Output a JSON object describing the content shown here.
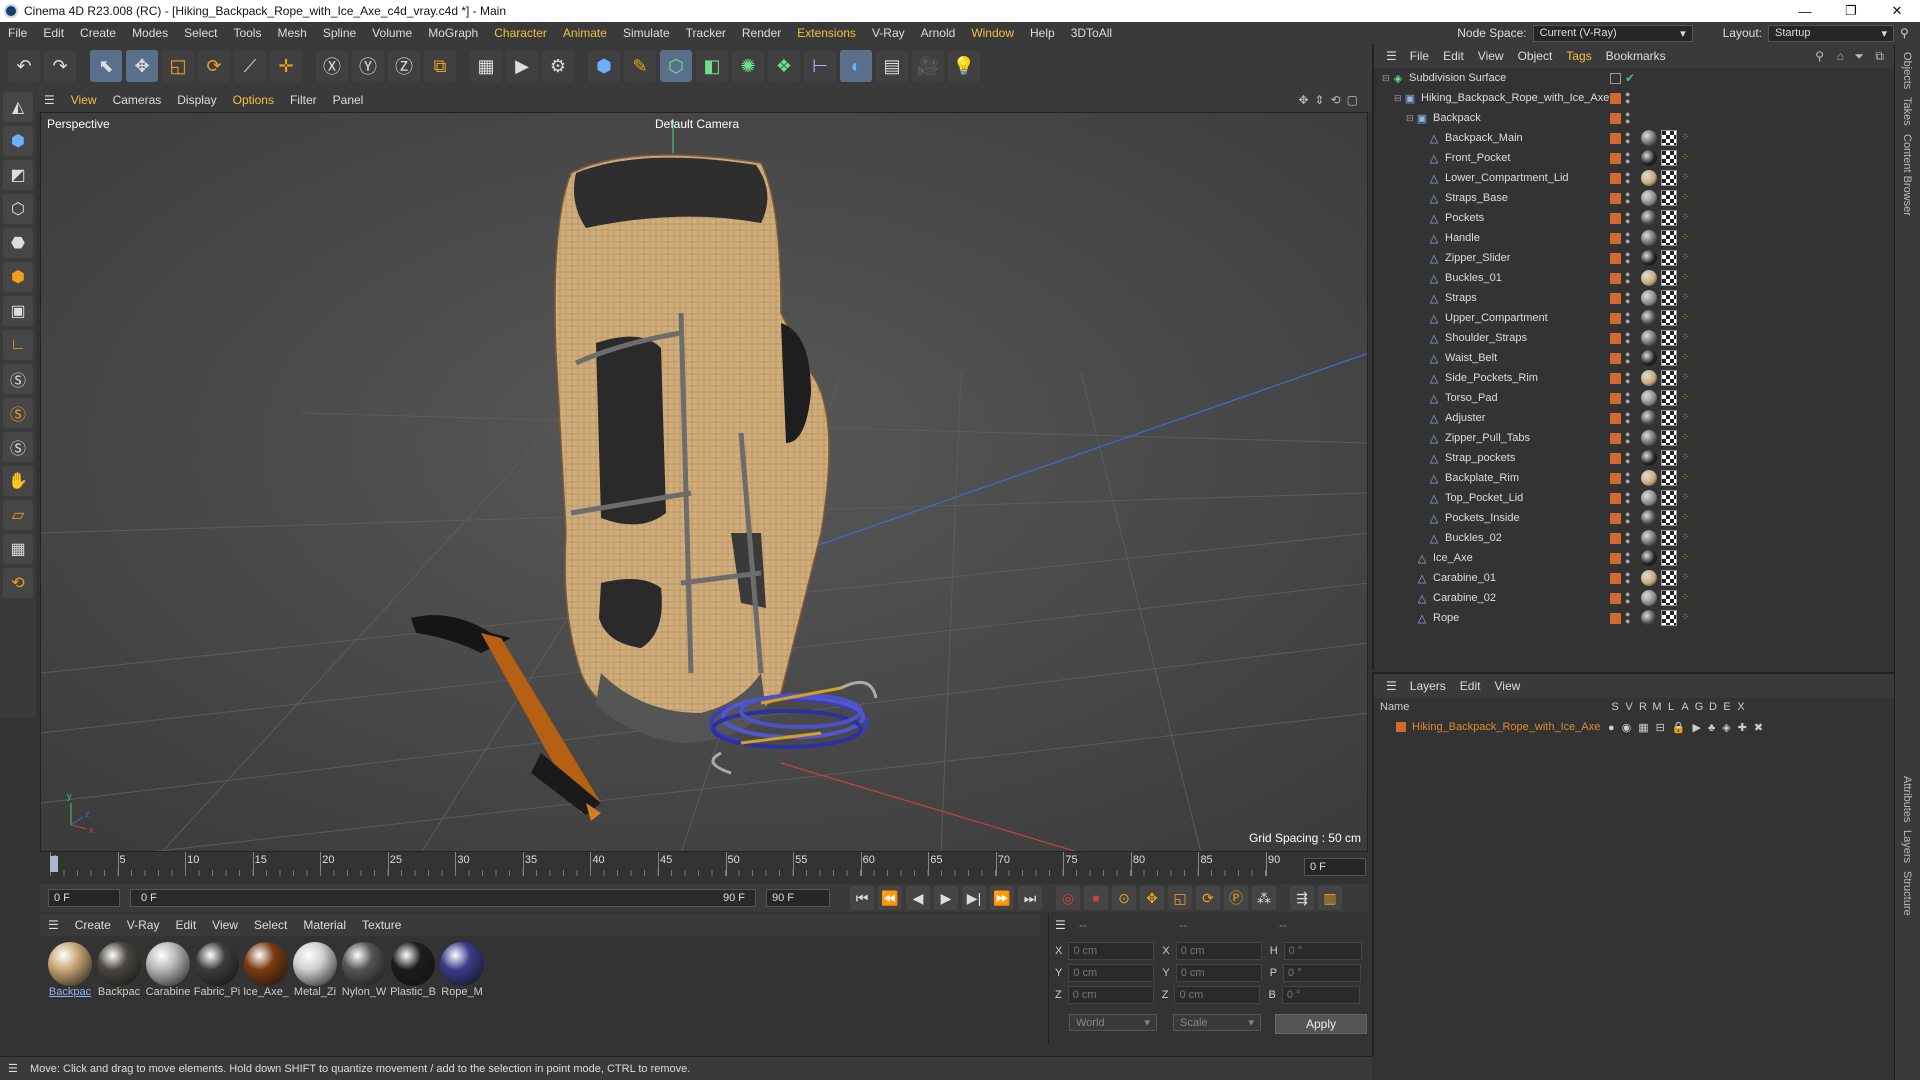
{
  "titlebar": {
    "title": "Cinema 4D R23.008 (RC) - [Hiking_Backpack_Rope_with_Ice_Axe_c4d_vray.c4d *] - Main",
    "minimize": "—",
    "maximize": "❐",
    "close": "✕"
  },
  "menubar": {
    "items": [
      "File",
      "Edit",
      "Create",
      "Modes",
      "Select",
      "Tools",
      "Mesh",
      "Spline",
      "Volume",
      "MoGraph",
      "Character",
      "Animate",
      "Simulate",
      "Tracker",
      "Render",
      "Extensions",
      "V-Ray",
      "Arnold",
      "Window",
      "Help",
      "3DToAll"
    ],
    "node_space_label": "Node Space:",
    "node_space_value": "Current (V-Ray)",
    "layout_label": "Layout:",
    "layout_value": "Startup"
  },
  "viewport_menu": {
    "items": [
      "View",
      "Cameras",
      "Display",
      "Options",
      "Filter",
      "Panel"
    ]
  },
  "viewport": {
    "projection": "Perspective",
    "camera": "Default Camera",
    "grid_spacing": "Grid Spacing : 50 cm"
  },
  "timeline": {
    "ticks": [
      "0",
      "5",
      "10",
      "15",
      "20",
      "25",
      "30",
      "35",
      "40",
      "45",
      "50",
      "55",
      "60",
      "65",
      "70",
      "75",
      "80",
      "85",
      "90"
    ],
    "current_frame_field": "0 F"
  },
  "playbar": {
    "start": "0 F",
    "current": "0 F",
    "end_slider": "90 F",
    "end": "90 F"
  },
  "material_menu": {
    "items": [
      "Create",
      "V-Ray",
      "Edit",
      "View",
      "Select",
      "Material",
      "Texture"
    ]
  },
  "materials": [
    {
      "name": "Backpac",
      "color": "#c9a777"
    },
    {
      "name": "Backpac",
      "color": "#4a4640"
    },
    {
      "name": "Carabine",
      "color": "#b8b8b8"
    },
    {
      "name": "Fabric_Pi",
      "color": "#3c3c3c"
    },
    {
      "name": "Ice_Axe_",
      "color": "#7a3c10"
    },
    {
      "name": "Metal_Zi",
      "color": "#d0d0d0"
    },
    {
      "name": "Nylon_W",
      "color": "#555555"
    },
    {
      "name": "Plastic_B",
      "color": "#1c1c1c"
    },
    {
      "name": "Rope_M",
      "color": "#3a3c8a"
    }
  ],
  "coords": {
    "header": "--",
    "header2": "--",
    "header3": "--",
    "rows": [
      {
        "a": "X",
        "av": "0 cm",
        "b": "X",
        "bv": "0 cm",
        "c": "H",
        "cv": "0 °"
      },
      {
        "a": "Y",
        "av": "0 cm",
        "b": "Y",
        "bv": "0 cm",
        "c": "P",
        "cv": "0 °"
      },
      {
        "a": "Z",
        "av": "0 cm",
        "b": "Z",
        "bv": "0 cm",
        "c": "B",
        "cv": "0 °"
      }
    ],
    "space": "World",
    "mode": "Scale",
    "apply": "Apply"
  },
  "status": "Move: Click and drag to move elements. Hold down SHIFT to quantize movement / add to the selection in point mode, CTRL to remove.",
  "object_manager": {
    "menu": [
      "File",
      "Edit",
      "View",
      "Object",
      "Tags",
      "Bookmarks"
    ],
    "objects": [
      {
        "name": "Subdivision Surface",
        "depth": 0,
        "icon": "◈"
      },
      {
        "name": "Hiking_Backpack_Rope_with_Ice_Axe",
        "depth": 1,
        "icon": "▣"
      },
      {
        "name": "Backpack",
        "depth": 2,
        "icon": "▣"
      },
      {
        "name": "Backpack_Main",
        "depth": 3,
        "icon": "△"
      },
      {
        "name": "Front_Pocket",
        "depth": 3,
        "icon": "△"
      },
      {
        "name": "Lower_Compartment_Lid",
        "depth": 3,
        "icon": "△"
      },
      {
        "name": "Straps_Base",
        "depth": 3,
        "icon": "△"
      },
      {
        "name": "Pockets",
        "depth": 3,
        "icon": "△"
      },
      {
        "name": "Handle",
        "depth": 3,
        "icon": "△"
      },
      {
        "name": "Zipper_Slider",
        "depth": 3,
        "icon": "△"
      },
      {
        "name": "Buckles_01",
        "depth": 3,
        "icon": "△"
      },
      {
        "name": "Straps",
        "depth": 3,
        "icon": "△"
      },
      {
        "name": "Upper_Compartment",
        "depth": 3,
        "icon": "△"
      },
      {
        "name": "Shoulder_Straps",
        "depth": 3,
        "icon": "△"
      },
      {
        "name": "Waist_Belt",
        "depth": 3,
        "icon": "△"
      },
      {
        "name": "Side_Pockets_Rim",
        "depth": 3,
        "icon": "△"
      },
      {
        "name": "Torso_Pad",
        "depth": 3,
        "icon": "△"
      },
      {
        "name": "Adjuster",
        "depth": 3,
        "icon": "△"
      },
      {
        "name": "Zipper_Pull_Tabs",
        "depth": 3,
        "icon": "△"
      },
      {
        "name": "Strap_pockets",
        "depth": 3,
        "icon": "△"
      },
      {
        "name": "Backplate_Rim",
        "depth": 3,
        "icon": "△"
      },
      {
        "name": "Top_Pocket_Lid",
        "depth": 3,
        "icon": "△"
      },
      {
        "name": "Pockets_Inside",
        "depth": 3,
        "icon": "△"
      },
      {
        "name": "Buckles_02",
        "depth": 3,
        "icon": "△"
      },
      {
        "name": "Ice_Axe",
        "depth": 2,
        "icon": "△"
      },
      {
        "name": "Carabine_01",
        "depth": 2,
        "icon": "△"
      },
      {
        "name": "Carabine_02",
        "depth": 2,
        "icon": "△"
      },
      {
        "name": "Rope",
        "depth": 2,
        "icon": "△"
      }
    ]
  },
  "layers": {
    "menu": [
      "Layers",
      "Edit",
      "View"
    ],
    "name_header": "Name",
    "cols": [
      "S",
      "V",
      "R",
      "M",
      "L",
      "A",
      "G",
      "D",
      "E",
      "X"
    ],
    "layer_name": "Hiking_Backpack_Rope_with_Ice_Axe"
  },
  "side_tabs": [
    "Objects",
    "Takes",
    "Content Browser",
    "Attributes",
    "Layers",
    "Structure"
  ]
}
